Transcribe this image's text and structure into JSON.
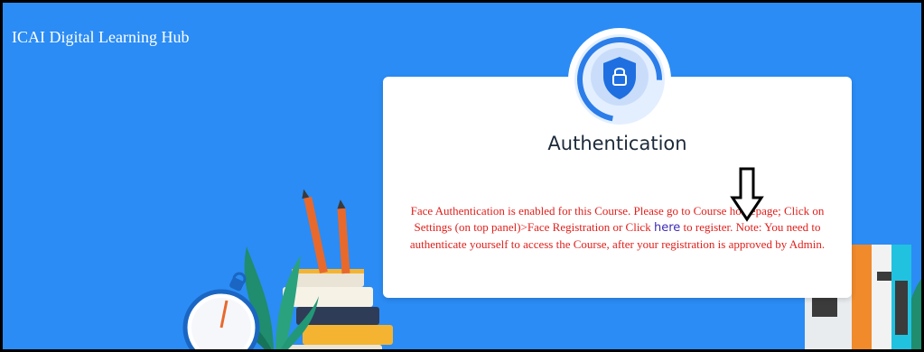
{
  "header": {
    "site_title": "ICAI Digital Learning Hub"
  },
  "dialog": {
    "title": "Authentication",
    "message_before_link": "Face Authentication is enabled for this Course. Please go to Course homepage; Click on Settings (on top panel)>Face Registration or Click ",
    "link_label": "here",
    "message_after_link": " to register. Note: You need to authenticate yourself to access the Course, after your registration is approved by Admin."
  },
  "icons": {
    "badge": "shield-lock-icon",
    "annotation": "down-arrow-icon"
  },
  "colors": {
    "background": "#2b8cf5",
    "message_text": "#e0201c",
    "link": "#3c2bb5",
    "badge_ring": "#2b7de9"
  }
}
